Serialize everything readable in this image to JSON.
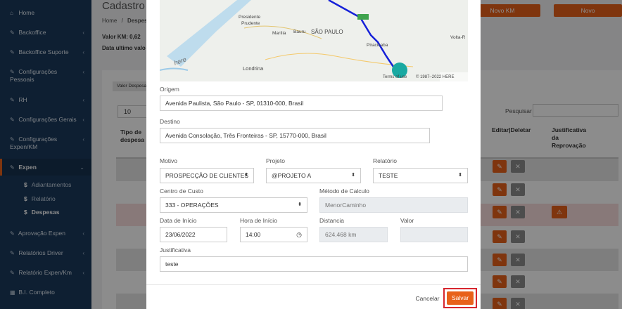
{
  "sidebar": {
    "items": [
      {
        "label": "Home",
        "icon": "home-icon"
      },
      {
        "label": "Backoffice",
        "icon": "edit-icon"
      },
      {
        "label": "Backoffice Suporte",
        "icon": "edit-icon"
      },
      {
        "label_l1": "Configurações",
        "label_l2": "Pessoais",
        "icon": "edit-icon"
      },
      {
        "label": "RH",
        "icon": "edit-icon"
      },
      {
        "label": "Configurações Gerais",
        "icon": "edit-icon"
      },
      {
        "label_l1": "Configurações",
        "label_l2": "Expen/KM",
        "icon": "edit-icon"
      },
      {
        "label": "Expen",
        "icon": "edit-icon"
      },
      {
        "label": "Aprovação Expen",
        "icon": "edit-icon"
      },
      {
        "label": "Relatórios Driver",
        "icon": "edit-icon"
      },
      {
        "label": "Relatório Expen/Km",
        "icon": "edit-icon"
      },
      {
        "label": "B.I. Completo",
        "icon": "grid-icon"
      }
    ],
    "subitems": [
      {
        "label": "Adiantamentos"
      },
      {
        "label": "Relatório"
      },
      {
        "label": "Despesas"
      }
    ],
    "dollar": "$"
  },
  "page": {
    "title": "Cadastro d",
    "breadcrumb_home": "Home",
    "breadcrumb_sep": "/",
    "breadcrumb_current": "Despes",
    "valor_km": "Valor KM: 0,62",
    "data_ultimo": "Data ultimo valo",
    "btn_novo_km": "Novo KM",
    "btn_novo": "Novo",
    "chip": "Valor Despesa",
    "page_size": "10",
    "pesquisar": "Pesquisar",
    "col_tipo": "Tipo de despesa",
    "col_editar": "Editar|Deletar",
    "col_justificativa_l1": "Justificativa",
    "col_justificativa_l2": "da",
    "col_justificativa_l3": "Reprovação"
  },
  "map": {
    "labels": {
      "presidente": "Presidente",
      "prudente": "Prudente",
      "marilia": "Marília",
      "bauru": "Bauru",
      "sao_paulo": "SÃO PAULO",
      "piracicaba": "Piracicaba",
      "volta": "Volta-R",
      "londrina": "Londrina",
      "here": "here",
      "terms": "Terms of use",
      "copy": "© 1987–2022 HERE"
    }
  },
  "form": {
    "origem_label": "Origem",
    "origem_value": "Avenida Paulista, São Paulo - SP, 01310-000, Brasil",
    "destino_label": "Destino",
    "destino_value": "Avenida Consolação, Três Fronteiras - SP, 15770-000, Brasil",
    "motivo_label": "Motivo",
    "motivo_value": "PROSPECÇÃO DE CLIENTES",
    "projeto_label": "Projeto",
    "projeto_value": "@PROJETO A",
    "relatorio_label": "Relatório",
    "relatorio_value": "TESTE",
    "centro_label": "Centro de Custo",
    "centro_value": "333 - OPERAÇÕES",
    "metodo_label": "Método de Calculo",
    "metodo_value": "MenorCaminho",
    "data_label": "Data de Início",
    "data_value": "23/06/2022",
    "hora_label": "Hora de Início",
    "hora_value": "14:00",
    "distancia_label": "Distancia",
    "distancia_value": "624.468 km",
    "valor_label": "Valor",
    "valor_value": "",
    "justificativa_label": "Justificativa",
    "justificativa_value": "teste",
    "cancel": "Cancelar",
    "save": "Salvar"
  },
  "colors": {
    "accent": "#e8611a",
    "sidebar": "#1b3a5c",
    "highlight": "#d7262e"
  }
}
